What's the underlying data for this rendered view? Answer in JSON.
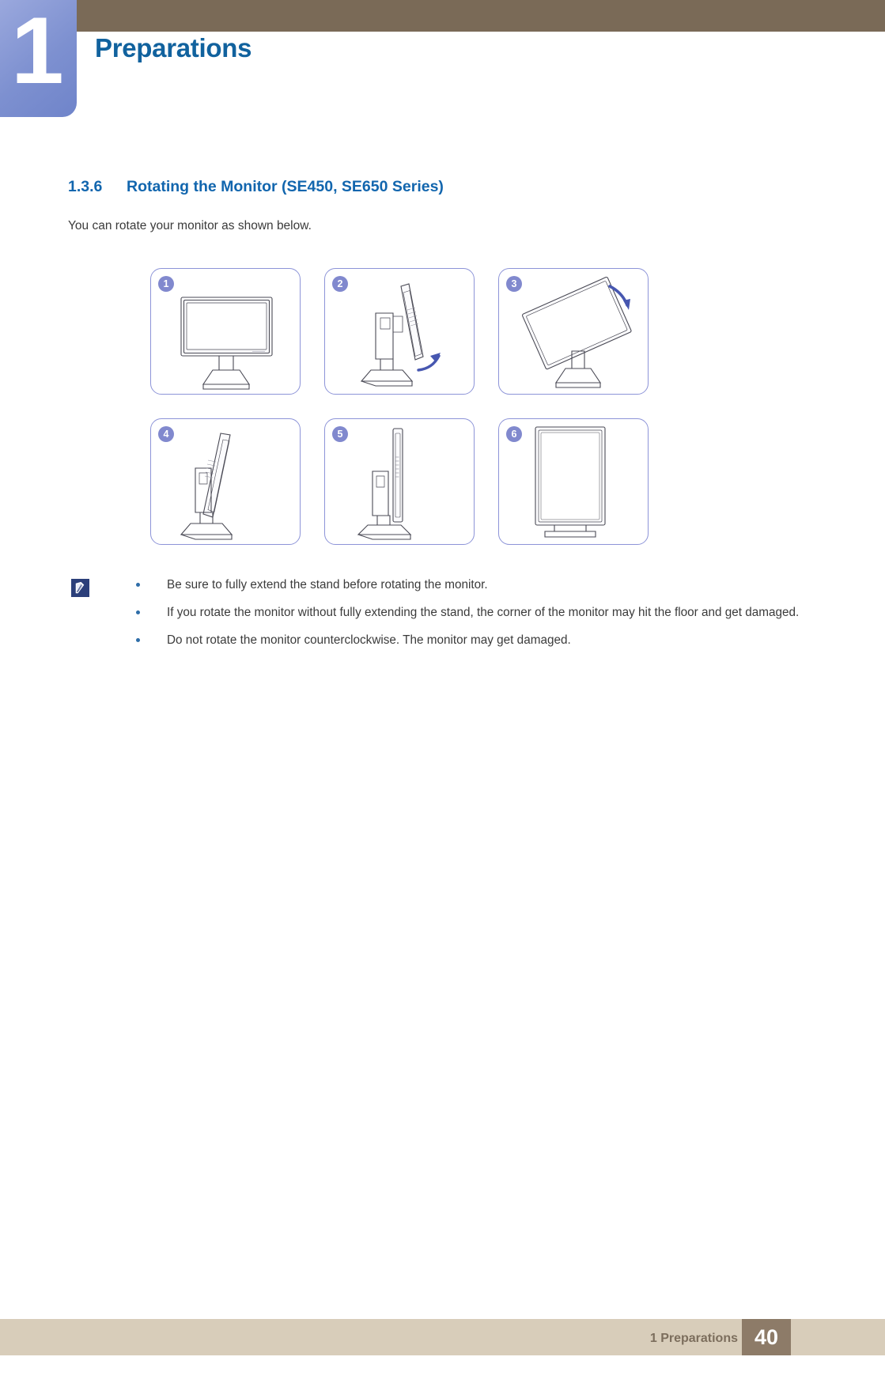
{
  "header": {
    "chapter_number": "1",
    "chapter_title": "Preparations",
    "band_color": "#7a6a57",
    "tab_color": "#7d90d0",
    "title_color": "#11629e"
  },
  "section": {
    "number": "1.3.6",
    "title": "Rotating the Monitor (SE450, SE650 Series)",
    "heading_color": "#1266ae",
    "intro": "You can rotate your monitor as shown below."
  },
  "figure": {
    "panel_border_color": "#8d94d8",
    "badge_color": "#8189ce",
    "rows": [
      [
        {
          "badge": "1",
          "illustration": "monitor-front-landscape"
        },
        {
          "badge": "2",
          "illustration": "monitor-side-tilt-arrow"
        },
        {
          "badge": "3",
          "illustration": "monitor-rotating-arrow"
        }
      ],
      [
        {
          "badge": "4",
          "illustration": "monitor-side-rotated"
        },
        {
          "badge": "5",
          "illustration": "monitor-side-portrait"
        },
        {
          "badge": "6",
          "illustration": "monitor-front-portrait"
        }
      ]
    ]
  },
  "note": {
    "icon": "note-pencil-icon",
    "bullets": [
      "Be sure to fully extend the stand before rotating the monitor.",
      "If you rotate the monitor without fully extending the stand, the corner of the monitor may hit the floor and get damaged.",
      "Do not rotate the monitor counterclockwise. The monitor may get damaged."
    ]
  },
  "footer": {
    "label": "1 Preparations",
    "page_number": "40",
    "band_color": "#d8cdba",
    "page_box_color": "#8d7b68"
  }
}
